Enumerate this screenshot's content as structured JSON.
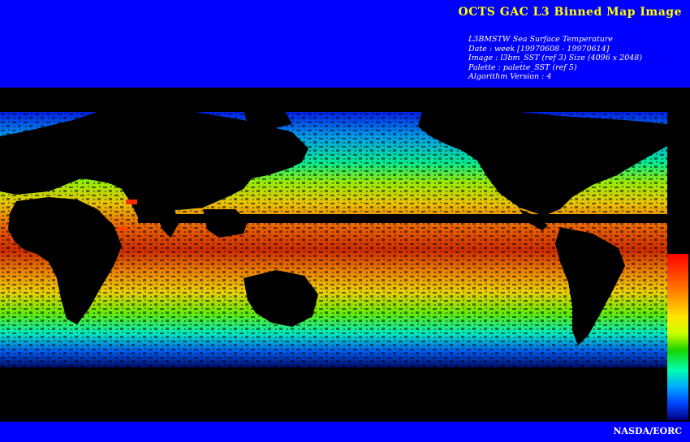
{
  "header": {
    "title": "OCTS GAC L3 Binned Map Image",
    "meta_lines": [
      "L3BMSTW Sea Surface Temperature",
      "Date : week [19970608 - 19970614]",
      "Image : l3bm_SST (ref 3) Size (4096 x 2048)",
      "Palette : palette_SST (ref 5)",
      "Algorithm Version : 4"
    ]
  },
  "footer": {
    "credit": "NASDA/EORC"
  },
  "colors": {
    "banner": "#0000ff",
    "title_text": "#ffff00",
    "meta_text": "#ffffff",
    "land": "#000000"
  },
  "map": {
    "type": "global sea surface temperature composite",
    "palette": [
      "#ff0000",
      "#ff7a00",
      "#ffe600",
      "#19d400",
      "#00ffb0",
      "#00aaff",
      "#0044ff",
      "#000080"
    ]
  }
}
